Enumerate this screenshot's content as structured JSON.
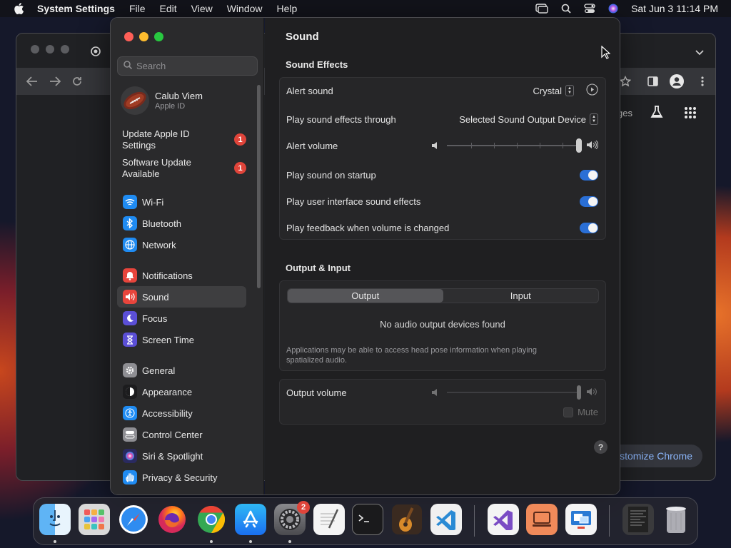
{
  "menubar": {
    "app_name": "System Settings",
    "items": [
      "File",
      "Edit",
      "View",
      "Window",
      "Help"
    ],
    "clock": "Sat Jun 3  11:14 PM"
  },
  "chrome": {
    "customize_label": "ustomize Chrome",
    "partial_label": "ges"
  },
  "sidebar": {
    "search_placeholder": "Search",
    "user_name": "Calub Viem",
    "user_sub": "Apple ID",
    "updates": [
      {
        "label_line1": "Update Apple ID",
        "label_line2": "Settings",
        "badge": "1"
      },
      {
        "label_line1": "Software Update",
        "label_line2": "Available",
        "badge": "1"
      }
    ],
    "group1": [
      {
        "label": "Wi-Fi",
        "icon": "wifi-icon",
        "color": "#1f8bf2"
      },
      {
        "label": "Bluetooth",
        "icon": "bluetooth-icon",
        "color": "#1f8bf2"
      },
      {
        "label": "Network",
        "icon": "globe-icon",
        "color": "#1f8bf2"
      }
    ],
    "group2": [
      {
        "label": "Notifications",
        "icon": "bell-icon",
        "color": "#e8453c"
      },
      {
        "label": "Sound",
        "icon": "speaker-icon",
        "color": "#e8453c",
        "selected": true
      },
      {
        "label": "Focus",
        "icon": "moon-icon",
        "color": "#5b4fd6"
      },
      {
        "label": "Screen Time",
        "icon": "hourglass-icon",
        "color": "#5b4fd6"
      }
    ],
    "group3": [
      {
        "label": "General",
        "icon": "gear-icon",
        "color": "#8e8e93"
      },
      {
        "label": "Appearance",
        "icon": "appearance-icon",
        "color": "#1c1c1e"
      },
      {
        "label": "Accessibility",
        "icon": "accessibility-icon",
        "color": "#1f8bf2"
      },
      {
        "label": "Control Center",
        "icon": "control-center-icon",
        "color": "#8e8e93"
      },
      {
        "label": "Siri & Spotlight",
        "icon": "siri-icon",
        "color": "#2a2a60"
      },
      {
        "label": "Privacy & Security",
        "icon": "hand-icon",
        "color": "#1f8bf2"
      }
    ]
  },
  "main": {
    "title": "Sound",
    "sound_effects": {
      "header": "Sound Effects",
      "alert_sound_label": "Alert sound",
      "alert_sound_value": "Crystal",
      "play_through_label": "Play sound effects through",
      "play_through_value": "Selected Sound Output Device",
      "alert_volume_label": "Alert volume",
      "alert_volume_level": 1.0,
      "startup_label": "Play sound on startup",
      "startup_on": true,
      "ui_effects_label": "Play user interface sound effects",
      "ui_effects_on": true,
      "feedback_label": "Play feedback when volume is changed",
      "feedback_on": true
    },
    "output_input": {
      "header": "Output & Input",
      "tab_output": "Output",
      "tab_input": "Input",
      "empty_message": "No audio output devices found",
      "note_line1": "Applications may be able to access head pose information when playing",
      "note_line2": "spatialized audio."
    },
    "output_volume": {
      "label": "Output volume",
      "level": 1.0,
      "mute_label": "Mute",
      "muted": false
    },
    "help": "?"
  },
  "dock": {
    "settings_badge": "2",
    "apps": [
      "Finder",
      "Launchpad",
      "Safari",
      "Firefox",
      "Chrome",
      "App Store",
      "System Settings",
      "TextEdit",
      "Terminal",
      "GarageBand",
      "Visual Studio Code",
      "Visual Studio",
      "Remote Desktop",
      "Screen Sharing"
    ]
  }
}
